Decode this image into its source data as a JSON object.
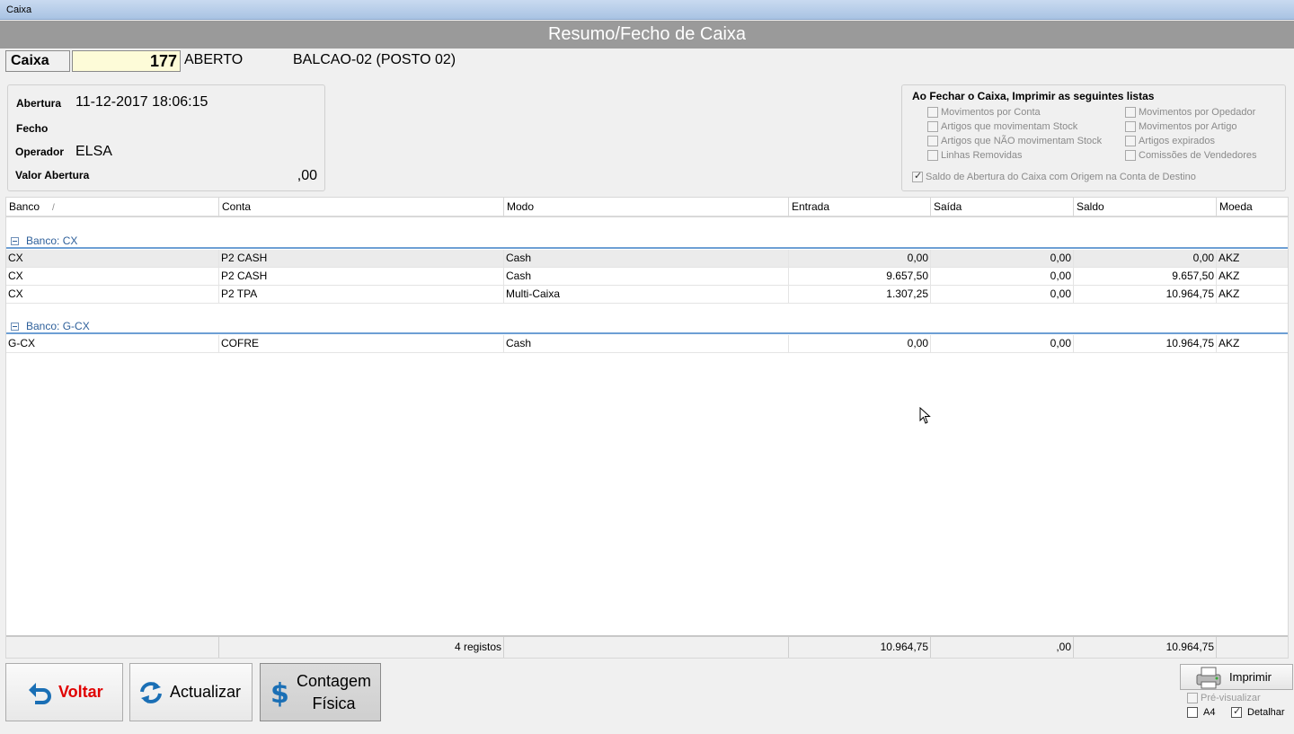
{
  "window": {
    "title": "Caixa"
  },
  "banner": {
    "title": "Resumo/Fecho de Caixa"
  },
  "caixa": {
    "label": "Caixa",
    "number": "177",
    "status": "ABERTO",
    "posto": "BALCAO-02 (POSTO 02)"
  },
  "info": {
    "abertura_label": "Abertura",
    "abertura_value": "11-12-2017 18:06:15",
    "fecho_label": "Fecho",
    "fecho_value": "",
    "operador_label": "Operador",
    "operador_value": "ELSA",
    "valor_abertura_label": "Valor Abertura",
    "valor_abertura_value": ",00"
  },
  "print_lists": {
    "title": "Ao Fechar o Caixa, Imprimir as seguintes listas",
    "options": [
      {
        "label": "Movimentos por Conta",
        "checked": false
      },
      {
        "label": "Movimentos por Opedador",
        "checked": false
      },
      {
        "label": "Artigos que movimentam Stock",
        "checked": false
      },
      {
        "label": "Movimentos por Artigo",
        "checked": false
      },
      {
        "label": "Artigos que NÃO movimentam Stock",
        "checked": false
      },
      {
        "label": "Artigos expirados",
        "checked": false
      },
      {
        "label": "Linhas Removidas",
        "checked": false
      },
      {
        "label": "Comissões de Vendedores",
        "checked": false
      },
      {
        "label": "Saldo de Abertura do Caixa com Origem na Conta de Destino",
        "checked": true
      }
    ]
  },
  "grid": {
    "columns": [
      "Banco",
      "Conta",
      "Modo",
      "Entrada",
      "Saída",
      "Saldo",
      "Moeda"
    ],
    "sort_indicator": "/",
    "groups": [
      {
        "label": "Banco: CX",
        "rows": [
          [
            "CX",
            "P2 CASH",
            "Cash",
            "0,00",
            "0,00",
            "0,00",
            "AKZ"
          ],
          [
            "CX",
            "P2 CASH",
            "Cash",
            "9.657,50",
            "0,00",
            "9.657,50",
            "AKZ"
          ],
          [
            "CX",
            "P2 TPA",
            "Multi-Caixa",
            "1.307,25",
            "0,00",
            "10.964,75",
            "AKZ"
          ]
        ]
      },
      {
        "label": "Banco: G-CX",
        "rows": [
          [
            "G-CX",
            "COFRE",
            "Cash",
            "0,00",
            "0,00",
            "10.964,75",
            "AKZ"
          ]
        ]
      }
    ],
    "footer": {
      "count": "4 registos",
      "entrada": "10.964,75",
      "saida": ",00",
      "saldo": "10.964,75"
    }
  },
  "buttons": {
    "voltar": "Voltar",
    "actualizar": "Actualizar",
    "contagem_line1": "Contagem",
    "contagem_line2": "Física"
  },
  "print_controls": {
    "imprimir": "Imprimir",
    "pre_visualizar": "Pré-visualizar",
    "a4": "A4",
    "detalhar": "Detalhar",
    "pre_checked": false,
    "a4_checked": false,
    "detalhar_checked": true
  },
  "colors": {
    "voltar_text": "#e00000",
    "banner_bg": "#9a9a9a",
    "group_text": "#2d5f9a",
    "caixa_field_bg": "#fdfbd8"
  }
}
